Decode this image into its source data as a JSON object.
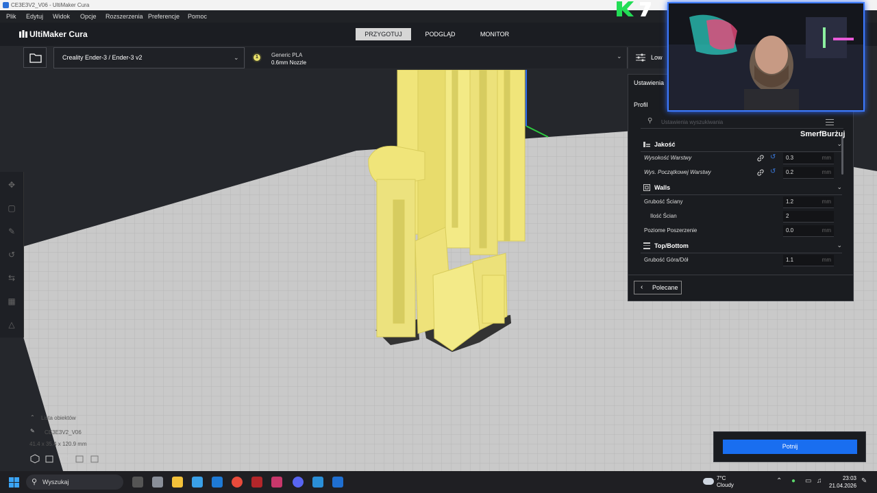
{
  "window": {
    "title": "CE3E3V2_V06 - UltiMaker Cura"
  },
  "menu": {
    "items": [
      "Plik",
      "Edytuj",
      "Widok",
      "Opcje",
      "Rozszerzenia",
      "Preferencje",
      "Pomoc"
    ]
  },
  "header": {
    "logo": "UltiMaker Cura",
    "stages": [
      "PRZYGOTUJ",
      "PODGLĄD",
      "MONITOR"
    ],
    "active_stage": "PRZYGOTUJ"
  },
  "toolbar": {
    "printer": "Creality Ender-3 / Ender-3 v2",
    "material_extruder": "1",
    "material_name": "Generic PLA",
    "nozzle": "0.6mm Nozzle",
    "settings_summary": "Low"
  },
  "settings_panel": {
    "header": "Ustawienia",
    "profile_label": "Profil",
    "search_placeholder": "Ustawienia wyszukiwania",
    "categories": {
      "quality": "Jakość",
      "walls": "Walls",
      "topbottom": "Top/Bottom"
    },
    "rows": {
      "layer_height": {
        "label": "Wysokość Warstwy",
        "value": "0.3",
        "unit": "mm"
      },
      "initial_layer_height": {
        "label": "Wys. Początkowej Warstwy",
        "value": "0.2",
        "unit": "mm"
      },
      "wall_thickness": {
        "label": "Grubość Ściany",
        "value": "1.2",
        "unit": "mm"
      },
      "wall_count": {
        "label": "Ilość Ścian",
        "value": "2"
      },
      "horizontal_expansion": {
        "label": "Poziome Poszerzenie",
        "value": "0.0",
        "unit": "mm"
      },
      "topbottom_thickness": {
        "label": "Grubość Góra/Dół",
        "value": "1.1",
        "unit": "mm"
      }
    },
    "recommended_button": "Polecane"
  },
  "object_list": {
    "title": "Lista obiektów",
    "object_name": "CE3E3V2_V06",
    "dimensions": "41.4 x 35.4 x 120.9 mm"
  },
  "slice_button": "Potnij",
  "overlay": {
    "streamer_name": "SmerfBurżuj",
    "badge": "K 7",
    "badge_color": "#22dd55",
    "cam_border_color": "#3d7bff"
  },
  "taskbar": {
    "search_label": "Wyszukaj",
    "weather_temp": "7°C",
    "weather_desc": "Cloudy",
    "time": "23:03",
    "date": "21.04.2026"
  },
  "colors": {
    "accent": "#196ef0",
    "model": "#f0e57a",
    "active_stage_bg": "#d6d6d6"
  }
}
